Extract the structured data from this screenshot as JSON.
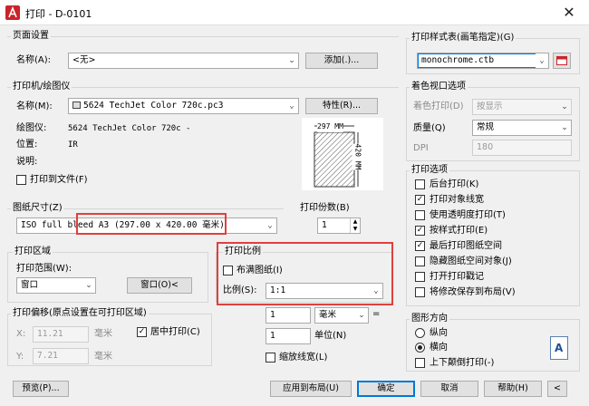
{
  "window": {
    "title": "打印 - D-0101",
    "close": "✕"
  },
  "page_setup": {
    "group_title": "页面设置",
    "name_label": "名称(A):",
    "name_value": "<无>",
    "add_button": "添加(.)..."
  },
  "printer": {
    "group_title": "打印机/绘图仪",
    "name_label": "名称(M):",
    "name_value": "5624 TechJet Color 720c.pc3",
    "properties_button": "特性(R)...",
    "plotter_label": "绘图仪:",
    "plotter_value": "5624 TechJet Color 720c -",
    "location_label": "位置:",
    "location_value": "IR",
    "description_label": "说明:",
    "print_to_file": "打印到文件(F)",
    "preview_width": "297 MM",
    "preview_height": "420 MM"
  },
  "paper_size": {
    "group_title": "图纸尺寸(Z)",
    "value": "ISO full bleed A3 (297.00 x 420.00 毫米)"
  },
  "copies": {
    "group_title": "打印份数(B)",
    "value": "1"
  },
  "plot_area": {
    "group_title": "打印区域",
    "range_label": "打印范围(W):",
    "range_value": "窗口",
    "window_button": "窗口(O)<"
  },
  "plot_scale": {
    "group_title": "打印比例",
    "fit_to_paper": "布满图纸(I)",
    "scale_label": "比例(S):",
    "scale_value": "1:1",
    "value1": "1",
    "unit": "毫米",
    "equals": "=",
    "value2": "1",
    "unit_label": "单位(N)",
    "scale_lineweights": "缩放线宽(L)"
  },
  "plot_offset": {
    "group_title": "打印偏移(原点设置在可打印区域)",
    "x_label": "X:",
    "x_value": "11.21",
    "x_unit": "毫米",
    "y_label": "Y:",
    "y_value": "7.21",
    "y_unit": "毫米",
    "center_plot": "居中打印(C)"
  },
  "plot_style_table": {
    "group_title": "打印样式表(画笔指定)(G)",
    "value": "monochrome.ctb"
  },
  "shaded_viewport": {
    "group_title": "着色视口选项",
    "shaded_label": "着色打印(D)",
    "shaded_value": "按显示",
    "quality_label": "质量(Q)",
    "quality_value": "常规",
    "dpi_label": "DPI",
    "dpi_value": "180"
  },
  "plot_options": {
    "group_title": "打印选项",
    "items": [
      {
        "label": "后台打印(K)",
        "checked": false
      },
      {
        "label": "打印对象线宽",
        "checked": true
      },
      {
        "label": "使用透明度打印(T)",
        "checked": false
      },
      {
        "label": "按样式打印(E)",
        "checked": true
      },
      {
        "label": "最后打印图纸空间",
        "checked": true
      },
      {
        "label": "隐藏图纸空间对象(J)",
        "checked": false
      },
      {
        "label": "打开打印戳记",
        "checked": false
      },
      {
        "label": "将修改保存到布局(V)",
        "checked": false
      }
    ]
  },
  "orientation": {
    "group_title": "图形方向",
    "portrait": "纵向",
    "landscape": "横向",
    "upside_down": "上下颠倒打印(-)",
    "icon_letter": "A"
  },
  "footer": {
    "preview": "预览(P)...",
    "apply_to_layout": "应用到布局(U)",
    "ok": "确定",
    "cancel": "取消",
    "help": "帮助(H)",
    "collapse": "<"
  },
  "colors": {
    "highlight": "#e0403f",
    "default_button_border": "#0078d7"
  }
}
